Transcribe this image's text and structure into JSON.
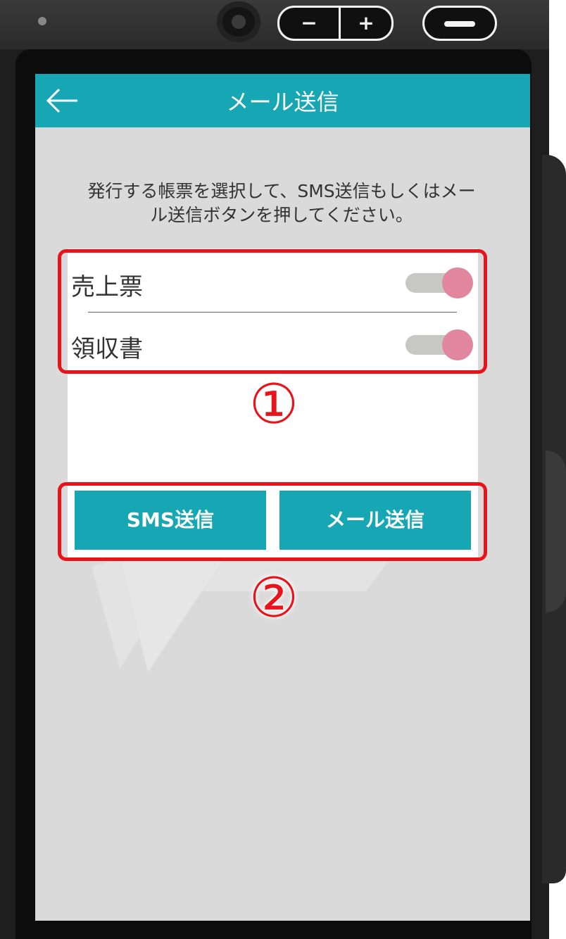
{
  "device": {
    "volume_down_label": "−",
    "volume_up_label": "+"
  },
  "appbar": {
    "title": "メール送信",
    "back_icon": "arrow-left-icon"
  },
  "instruction": {
    "line1": "発行する帳票を選択して、SMS送信もしくはメー",
    "line2": "ル送信ボタンを押してください。"
  },
  "documents": [
    {
      "label": "売上票",
      "enabled": true
    },
    {
      "label": "領収書",
      "enabled": true
    }
  ],
  "actions": {
    "sms_label": "SMS送信",
    "mail_label": "メール送信"
  },
  "callouts": {
    "one": "①",
    "two": "②"
  },
  "colors": {
    "accent": "#17a6b4",
    "toggle_on": "#e0869f",
    "highlight": "#e8141c"
  }
}
